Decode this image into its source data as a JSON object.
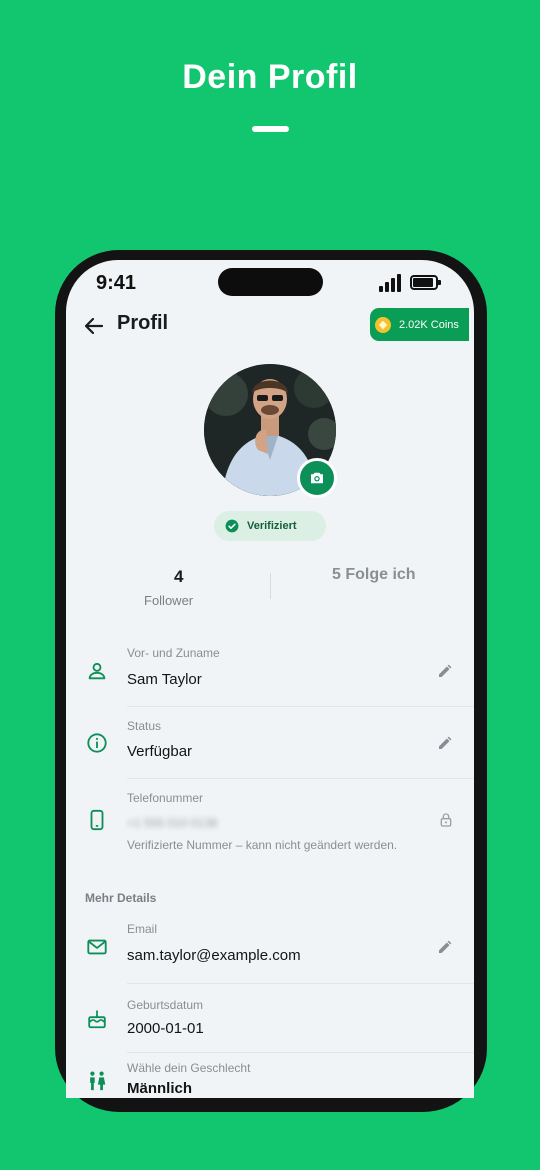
{
  "hero": {
    "title": "Dein Profil"
  },
  "status_bar": {
    "time": "9:41"
  },
  "app_bar": {
    "title": "Profil",
    "back_icon": "arrow-left-icon",
    "coins_label": "2.02K Coins",
    "coin_icon": "coin-icon"
  },
  "profile": {
    "verified_label": "Verifiziert",
    "camera_icon": "camera-icon"
  },
  "stats": {
    "followers_count": "4",
    "followers_label": "Follower",
    "following_label": "5 Folge ich"
  },
  "fields": {
    "name": {
      "label": "Vor- und Zuname",
      "value": "Sam Taylor"
    },
    "status": {
      "label": "Status",
      "value": "Verfügbar"
    },
    "phone": {
      "label": "Telefonummer",
      "value": "+1 555 010 0138",
      "note": "Verifizierte Nummer – kann nicht geändert werden."
    }
  },
  "more_details": {
    "title": "Mehr Details",
    "email": {
      "label": "Email",
      "value": "sam.taylor@example.com"
    },
    "birthday": {
      "label": "Geburtsdatum",
      "value": "2000-01-01"
    },
    "gender": {
      "label": "Wähle dein Geschlecht",
      "value": "Männlich"
    }
  },
  "colors": {
    "brand_green": "#11c66e",
    "accent_dark_green": "#0a9d55",
    "icon_green": "#0c8f58"
  }
}
